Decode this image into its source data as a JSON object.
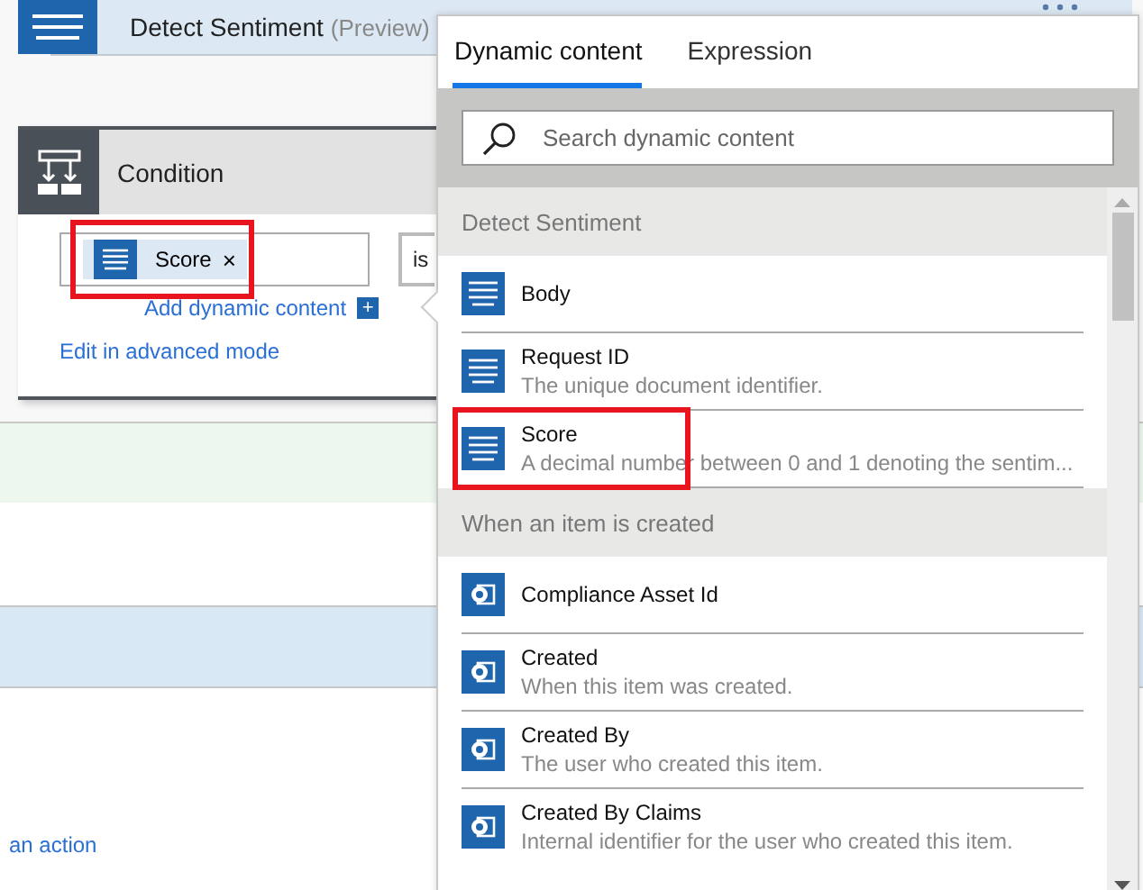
{
  "background": {
    "header": {
      "title": "Detect Sentiment",
      "suffix": "(Preview)"
    },
    "link": "an action"
  },
  "condition": {
    "title": "Condition",
    "token": {
      "label": "Score",
      "remove": "×",
      "highlighted": true
    },
    "operator": "is",
    "add_link": "Add dynamic content",
    "add_icon": "+",
    "advanced_link": "Edit in advanced mode"
  },
  "panel": {
    "tabs": [
      {
        "label": "Dynamic content",
        "selected": true
      },
      {
        "label": "Expression",
        "selected": false
      }
    ],
    "search": {
      "placeholder": "Search dynamic content"
    },
    "sections": [
      {
        "title": "Detect Sentiment",
        "items": [
          {
            "kind": "text",
            "label": "Body",
            "highlighted": false
          },
          {
            "kind": "text",
            "label": "Request ID",
            "description": "The unique document identifier.",
            "highlighted": false
          },
          {
            "kind": "text",
            "label": "Score",
            "description": "A decimal number between 0 and 1 denoting the sentim...",
            "highlighted": true
          }
        ]
      },
      {
        "title": "When an item is created",
        "items": [
          {
            "kind": "list",
            "label": "Compliance Asset Id",
            "highlighted": false
          },
          {
            "kind": "list",
            "label": "Created",
            "description": "When this item was created.",
            "highlighted": false
          },
          {
            "kind": "list",
            "label": "Created By",
            "description": "The user who created this item.",
            "highlighted": false
          },
          {
            "kind": "list",
            "label": "Created By Claims",
            "description": "Internal identifier for the user who created this item.",
            "highlighted": false
          }
        ]
      }
    ]
  }
}
